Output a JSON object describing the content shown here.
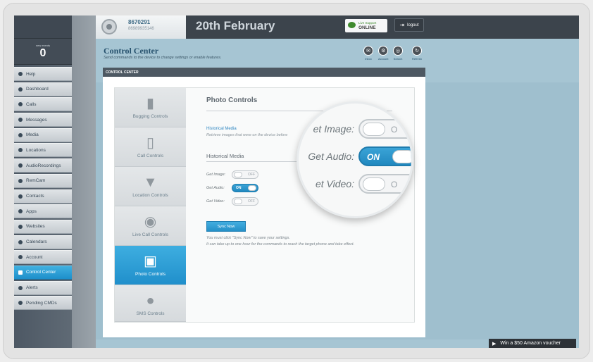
{
  "events": {
    "label": "new events",
    "count": "0"
  },
  "sidebar": {
    "items": [
      {
        "label": "Help",
        "icon": "info-icon"
      },
      {
        "label": "Dashboard",
        "icon": "rocket-icon"
      },
      {
        "label": "Calls",
        "icon": "phone-icon"
      },
      {
        "label": "Messages",
        "icon": "chat-icon"
      },
      {
        "label": "Media",
        "icon": "image-icon"
      },
      {
        "label": "Locations",
        "icon": "pin-icon"
      },
      {
        "label": "AudioRecordings",
        "icon": "audio-icon"
      },
      {
        "label": "RemCam",
        "icon": "camera-icon"
      },
      {
        "label": "Contacts",
        "icon": "contacts-icon"
      },
      {
        "label": "Apps",
        "icon": "gear-icon"
      },
      {
        "label": "Websites",
        "icon": "link-icon"
      },
      {
        "label": "Calendars",
        "icon": "calendar-icon"
      },
      {
        "label": "Account",
        "icon": "user-icon"
      },
      {
        "label": "Control Center",
        "icon": "monitor-icon",
        "active": true
      },
      {
        "label": "Alerts",
        "icon": "signal-icon"
      },
      {
        "label": "Pending CMDs",
        "icon": "clock-icon"
      }
    ]
  },
  "user": {
    "id": "8670291",
    "phone": "86989935146"
  },
  "header": {
    "date": "20th February",
    "live_support": {
      "line1": "Live Support",
      "line2": "ONLINE"
    },
    "logout": "logout"
  },
  "page": {
    "title": "Control Center",
    "subtitle": "Send commands to the device to change settings or enable features.",
    "tools": [
      {
        "label": "Inbox",
        "icon": "inbox-icon"
      },
      {
        "label": "Account",
        "icon": "gear-icon"
      },
      {
        "label": "Search",
        "icon": "search-icon"
      },
      {
        "label": "Refresh",
        "icon": "refresh-icon"
      }
    ],
    "panel_title": "CONTROL CENTER"
  },
  "tabs": [
    {
      "label": "Bugging Controls",
      "icon": "microphone-icon"
    },
    {
      "label": "Call Controls",
      "icon": "mobile-icon"
    },
    {
      "label": "Location Controls",
      "icon": "map-pin-icon"
    },
    {
      "label": "Live Call Controls",
      "icon": "eye-icon"
    },
    {
      "label": "Photo Controls",
      "icon": "camera-icon",
      "active": true
    },
    {
      "label": "SMS Controls",
      "icon": "speech-bubble-icon"
    }
  ],
  "photo": {
    "title": "Photo Controls",
    "link": "Historical Media",
    "desc": "Retrieve images that were on the device before",
    "section": "Historical Media",
    "rows": [
      {
        "label": "Get Image:",
        "state": "OFF"
      },
      {
        "label": "Get Audio:",
        "state": "ON"
      },
      {
        "label": "Get Video:",
        "state": "OFF"
      }
    ],
    "sync_button": "Sync Now",
    "note1": "You must click \"Sync Now\" to save your settings.",
    "note2": "It can take up to one hour for the commands to reach the target phone and take effect."
  },
  "magnifier": {
    "rows": [
      {
        "label": "et Image:",
        "state": "O"
      },
      {
        "label": "Get Audio:",
        "state": "ON"
      },
      {
        "label": "et Video:",
        "state": "O"
      }
    ]
  },
  "voucher": "Win a $50 Amazon voucher"
}
